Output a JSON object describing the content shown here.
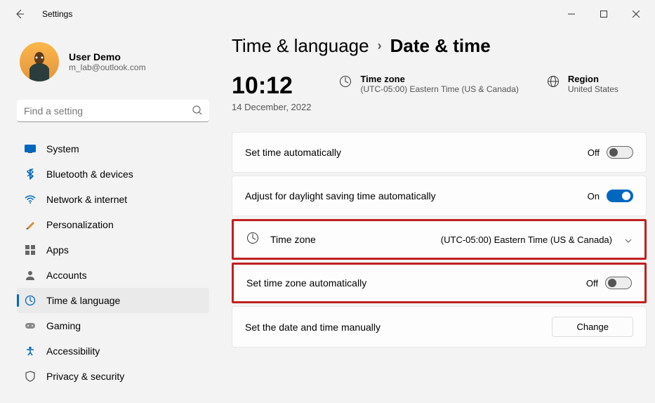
{
  "window": {
    "title": "Settings"
  },
  "user": {
    "name": "User Demo",
    "email": "m_lab@outlook.com"
  },
  "search": {
    "placeholder": "Find a setting"
  },
  "nav": {
    "items": [
      {
        "label": "System"
      },
      {
        "label": "Bluetooth & devices"
      },
      {
        "label": "Network & internet"
      },
      {
        "label": "Personalization"
      },
      {
        "label": "Apps"
      },
      {
        "label": "Accounts"
      },
      {
        "label": "Time & language"
      },
      {
        "label": "Gaming"
      },
      {
        "label": "Accessibility"
      },
      {
        "label": "Privacy & security"
      }
    ]
  },
  "breadcrumb": {
    "parent": "Time & language",
    "current": "Date & time"
  },
  "clock": {
    "time": "10:12",
    "date": "14 December, 2022"
  },
  "info": {
    "timezone": {
      "label": "Time zone",
      "value": "(UTC-05:00) Eastern Time (US & Canada)"
    },
    "region": {
      "label": "Region",
      "value": "United States"
    }
  },
  "settings": {
    "setTimeAuto": {
      "label": "Set time automatically",
      "state": "Off"
    },
    "dstAuto": {
      "label": "Adjust for daylight saving time automatically",
      "state": "On"
    },
    "timeZone": {
      "label": "Time zone",
      "value": "(UTC-05:00) Eastern Time (US & Canada)"
    },
    "setTzAuto": {
      "label": "Set time zone automatically",
      "state": "Off"
    },
    "manual": {
      "label": "Set the date and time manually",
      "button": "Change"
    }
  }
}
